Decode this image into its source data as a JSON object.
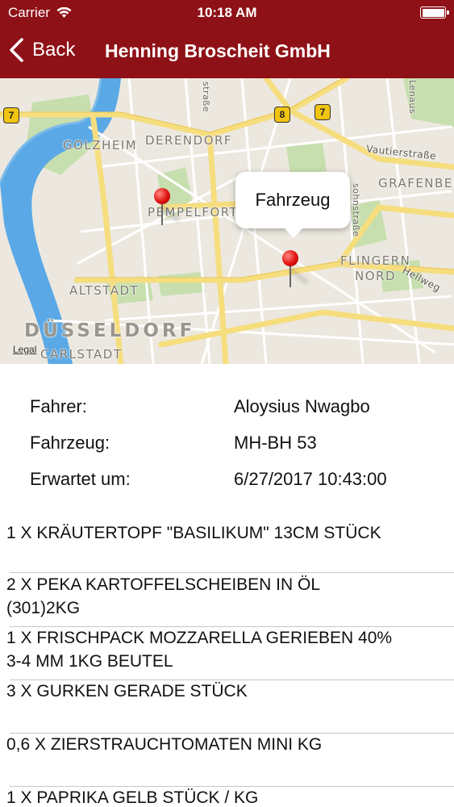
{
  "status_bar": {
    "carrier": "Carrier",
    "time": "10:18 AM",
    "wifi_icon": "wifi-icon",
    "battery_icon": "battery-icon"
  },
  "nav": {
    "back_label": "Back",
    "back_icon": "chevron-left-icon",
    "title": "Henning Broscheit GmbH",
    "bar_color": "#8e1117"
  },
  "map": {
    "labels": {
      "golzheim": "GOLZHEIM",
      "derendorf": "DERENDORF",
      "pempelfort": "PEMPELFORT",
      "grafenberg": "GRAFENBER",
      "flingern_1": "FLINGERN",
      "flingern_2": "NORD",
      "altstadt": "ALTSTADT",
      "duesseldorf": "DÜSSELDORF",
      "carlstadt": "CARLSTADT",
      "vautierstrasse": "Vautierstraße",
      "hellweg": "Hellweg",
      "strasse_top": "straße",
      "lenaus": "Lenaus",
      "sohnstrasse": "sohnstraße"
    },
    "shields": [
      "7",
      "8",
      "7"
    ],
    "legal": "Legal",
    "callout": "Fahrzeug",
    "pin_icon": "map-pin-icon"
  },
  "details": [
    {
      "label": "Fahrer:",
      "value": "Aloysius Nwagbo"
    },
    {
      "label": "Fahrzeug:",
      "value": "MH-BH 53"
    },
    {
      "label": "Erwartet um:",
      "value": "6/27/2017 10:43:00"
    }
  ],
  "items": [
    {
      "line1": "1 X KRÄUTERTOPF \"BASILIKUM\" 13CM STÜCK",
      "line2": ""
    },
    {
      "line1": "2 X PEKA KARTOFFELSCHEIBEN IN ÖL",
      "line2": "(301)2KG"
    },
    {
      "line1": "1 X FRISCHPACK MOZZARELLA GERIEBEN 40%",
      "line2": "3-4 MM 1KG BEUTEL"
    },
    {
      "line1": "3 X GURKEN  GERADE  STÜCK",
      "line2": ""
    },
    {
      "line1": "0,6 X ZIERSTRAUCHTOMATEN  MINI KG",
      "line2": ""
    },
    {
      "line1": "1 X PAPRIKA GELB STÜCK / KG",
      "line2": ""
    }
  ]
}
